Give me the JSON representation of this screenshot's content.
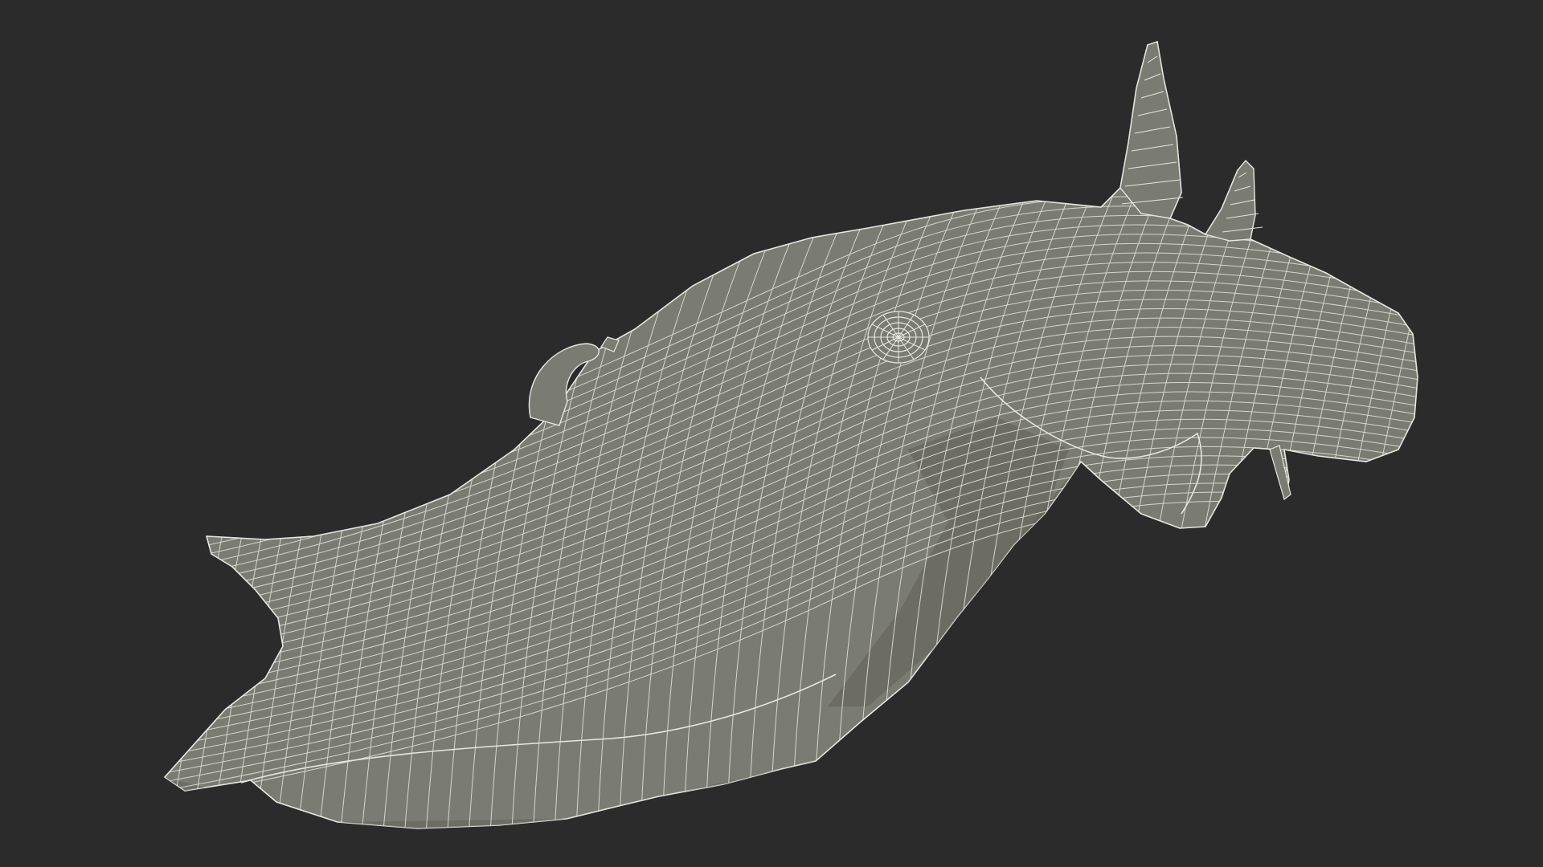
{
  "scene": {
    "background_color": "#2b2b2b",
    "model_fill_color": "#7a7b72",
    "model_shadow_color": "#62635b",
    "wireframe_color": "#e7e7e2",
    "subject": "wireframe-3d-model"
  }
}
